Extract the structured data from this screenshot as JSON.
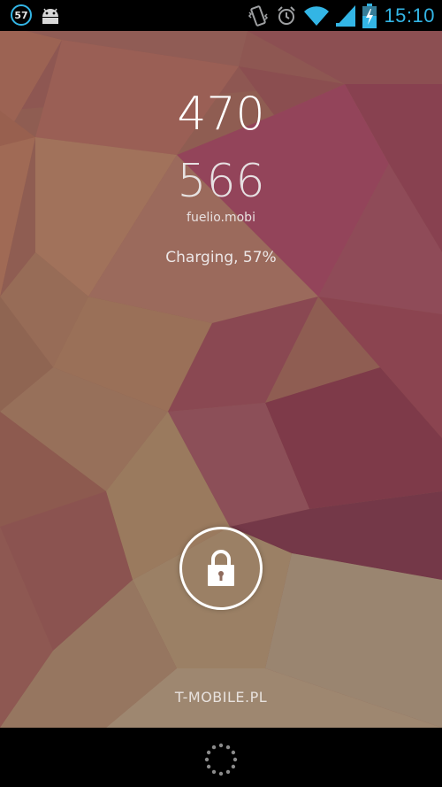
{
  "status_bar": {
    "notification_count": "57",
    "time": "15:10",
    "icons": [
      "notification-count-icon",
      "android-robot-icon",
      "vibrate-icon",
      "alarm-clock-icon",
      "wifi-icon",
      "signal-icon",
      "battery-charging-icon"
    ],
    "accent_color": "#33b5e5"
  },
  "lockscreen": {
    "line1": "470",
    "line2": "566",
    "owner_info": "fuelio.mobi",
    "charging_status": "Charging, 57%",
    "carrier": "T-MOBILE.PL",
    "unlock_icon": "lock-icon"
  },
  "nav_bar": {
    "icon": "loading-spinner-icon"
  }
}
